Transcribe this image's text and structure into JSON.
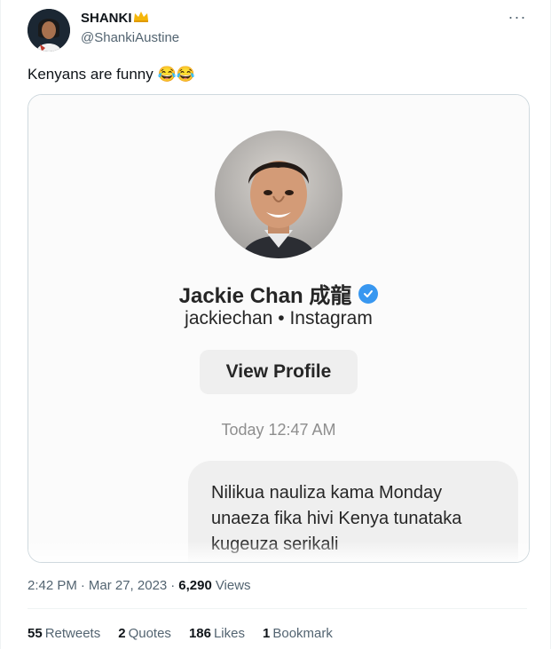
{
  "author": {
    "name": "SHANKI",
    "handle": "@ShankiAustine",
    "badge_icon": "crown-icon"
  },
  "more_icon": "···",
  "tweet": {
    "text": "Kenyans are funny 😂😂"
  },
  "screenshot": {
    "display_name": "Jackie Chan 成龍",
    "username": "jackiechan",
    "platform": "Instagram",
    "sub_separator": " • ",
    "view_profile_label": "View Profile",
    "timestamp": "Today 12:47 AM",
    "message_lines": [
      "Nilikua nauliza kama Monday",
      "unaeza fika hivi Kenya tunataka",
      "kugeuza serikali"
    ],
    "verified_color": "#3897f0"
  },
  "meta": {
    "time": "2:42 PM",
    "separator": "·",
    "date": "Mar 27, 2023",
    "views_count": "6,290",
    "views_label": "Views"
  },
  "stats": {
    "retweets": {
      "count": "55",
      "label": "Retweets"
    },
    "quotes": {
      "count": "2",
      "label": "Quotes"
    },
    "likes": {
      "count": "186",
      "label": "Likes"
    },
    "bookmarks": {
      "count": "1",
      "label": "Bookmark"
    }
  }
}
